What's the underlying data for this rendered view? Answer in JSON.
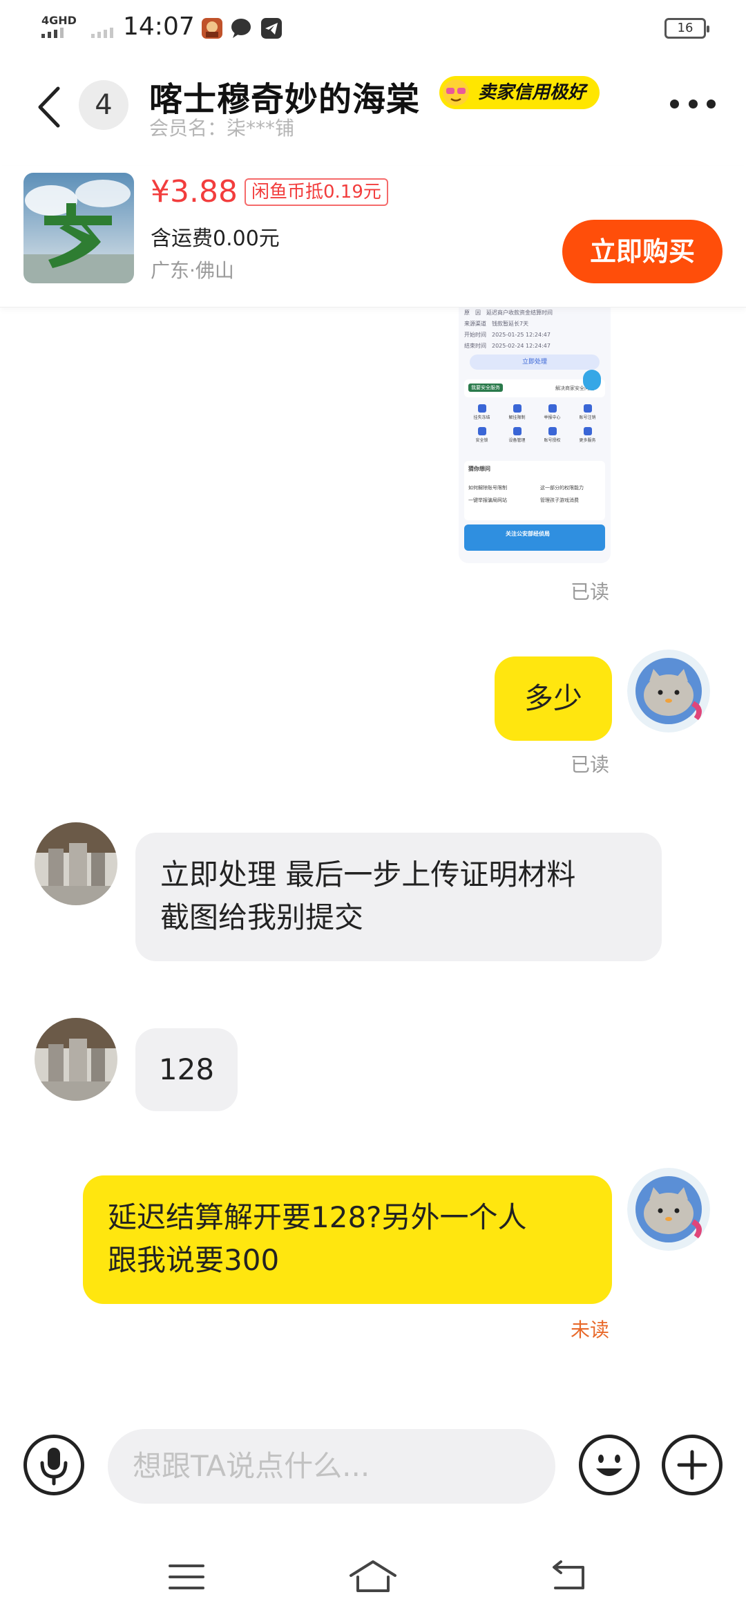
{
  "status_bar": {
    "network": "4GHD",
    "time": "14:07",
    "battery": "16"
  },
  "header": {
    "unread_count": "4",
    "title": "喀士穆奇妙的海棠",
    "seller_badge": "卖家信用极好",
    "member_label": "会员名：柒***铺"
  },
  "product": {
    "price": "¥3.88",
    "coin_tag": "闲鱼币抵0.19元",
    "shipping": "含运费0.00元",
    "location": "广东·佛山",
    "buy_button": "立即购买"
  },
  "screenshot_card": {
    "rows": [
      {
        "k": "原　因",
        "v": "延迟商户收款资金结算时间"
      },
      {
        "k": "来源渠道",
        "v": "钱款暂延长7天"
      },
      {
        "k": "开始时间",
        "v": "2025-01-25 12:24:47"
      },
      {
        "k": "结束时间",
        "v": "2025-02-24 12:24:47"
      }
    ],
    "action": "立即处理",
    "safety_tag": "我要安全服务",
    "safety_text": "解决商家安全问题",
    "grid": [
      "挂失冻结",
      "解挂限制",
      "举报中心",
      "账号注销",
      "安全锁",
      "设备管理",
      "账号授权",
      "更多服务"
    ],
    "faq_title": "猜你想问",
    "faq": [
      "如何解除账号限制",
      "这一部分的权限能力",
      "一键举报骗局网站",
      "管理孩子游戏消费"
    ],
    "banner": "关注公安部经侦局"
  },
  "messages": [
    {
      "side": "right",
      "status": "已读"
    },
    {
      "side": "right",
      "text": "多少",
      "status": "已读"
    },
    {
      "side": "left",
      "line1": "立即处理 最后一步上传证明材料",
      "line2": "截图给我别提交"
    },
    {
      "side": "left",
      "text": "128"
    },
    {
      "side": "right",
      "line1": "延迟结算解开要128?另外一个人",
      "line2": "跟我说要300",
      "status": "未读"
    }
  ],
  "input": {
    "placeholder": "想跟TA说点什么..."
  },
  "colors": {
    "accent_yellow": "#ffe60f",
    "price_red": "#f23d3d",
    "buy_orange": "#ff4e0a",
    "unread_orange": "#e8692a"
  },
  "icons": [
    "back-icon",
    "more-icon",
    "microphone-icon",
    "emoji-icon",
    "plus-icon",
    "menu-icon",
    "home-icon",
    "back-nav-icon"
  ]
}
